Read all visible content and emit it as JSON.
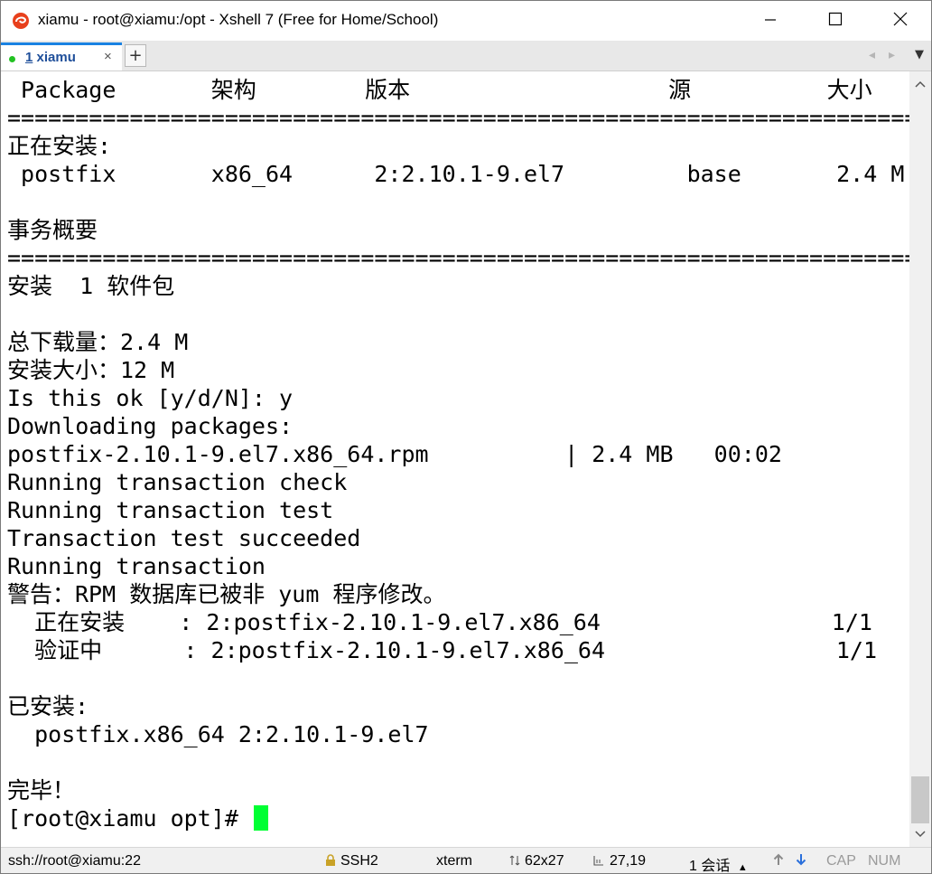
{
  "window": {
    "title": "xiamu - root@xiamu:/opt - Xshell 7 (Free for Home/School)",
    "icon": "xshell-logo-icon",
    "controls": [
      "minimize-icon",
      "maximize-icon",
      "close-icon"
    ]
  },
  "tabs": [
    {
      "number": "1",
      "label": "xiamu",
      "status_color": "#22c222",
      "accent": "#1a82e2"
    }
  ],
  "tab_close": "×",
  "tab_add": "+",
  "terminal": {
    "lines": [
      " Package       架构        版本                   源          大小",
      "============================================================================",
      "正在安装:",
      " postfix       x86_64      2:2.10.1-9.el7         base       2.4 M",
      "",
      "事务概要",
      "============================================================================",
      "安装  1 软件包",
      "",
      "总下载量：2.4 M",
      "安装大小：12 M",
      "Is this ok [y/d/N]: y",
      "Downloading packages:",
      "postfix-2.10.1-9.el7.x86_64.rpm          | 2.4 MB   00:02",
      "Running transaction check",
      "Running transaction test",
      "Transaction test succeeded",
      "Running transaction",
      "警告：RPM 数据库已被非 yum 程序修改。",
      "  正在安装    : 2:postfix-2.10.1-9.el7.x86_64                 1/1",
      "  验证中      : 2:postfix-2.10.1-9.el7.x86_64                 1/1",
      "",
      "已安装:",
      "  postfix.x86_64 2:2.10.1-9.el7",
      "",
      "完毕！"
    ],
    "prompt": "[root@xiamu opt]# ",
    "cursor_color": "#00ff33"
  },
  "status": {
    "connection": "ssh://root@xiamu:22",
    "protocol": "SSH2",
    "term_type": "xterm",
    "size": "62x27",
    "cursor_pos": "27,19",
    "sessions": "1 会话",
    "caps": "CAP",
    "num": "NUM"
  }
}
